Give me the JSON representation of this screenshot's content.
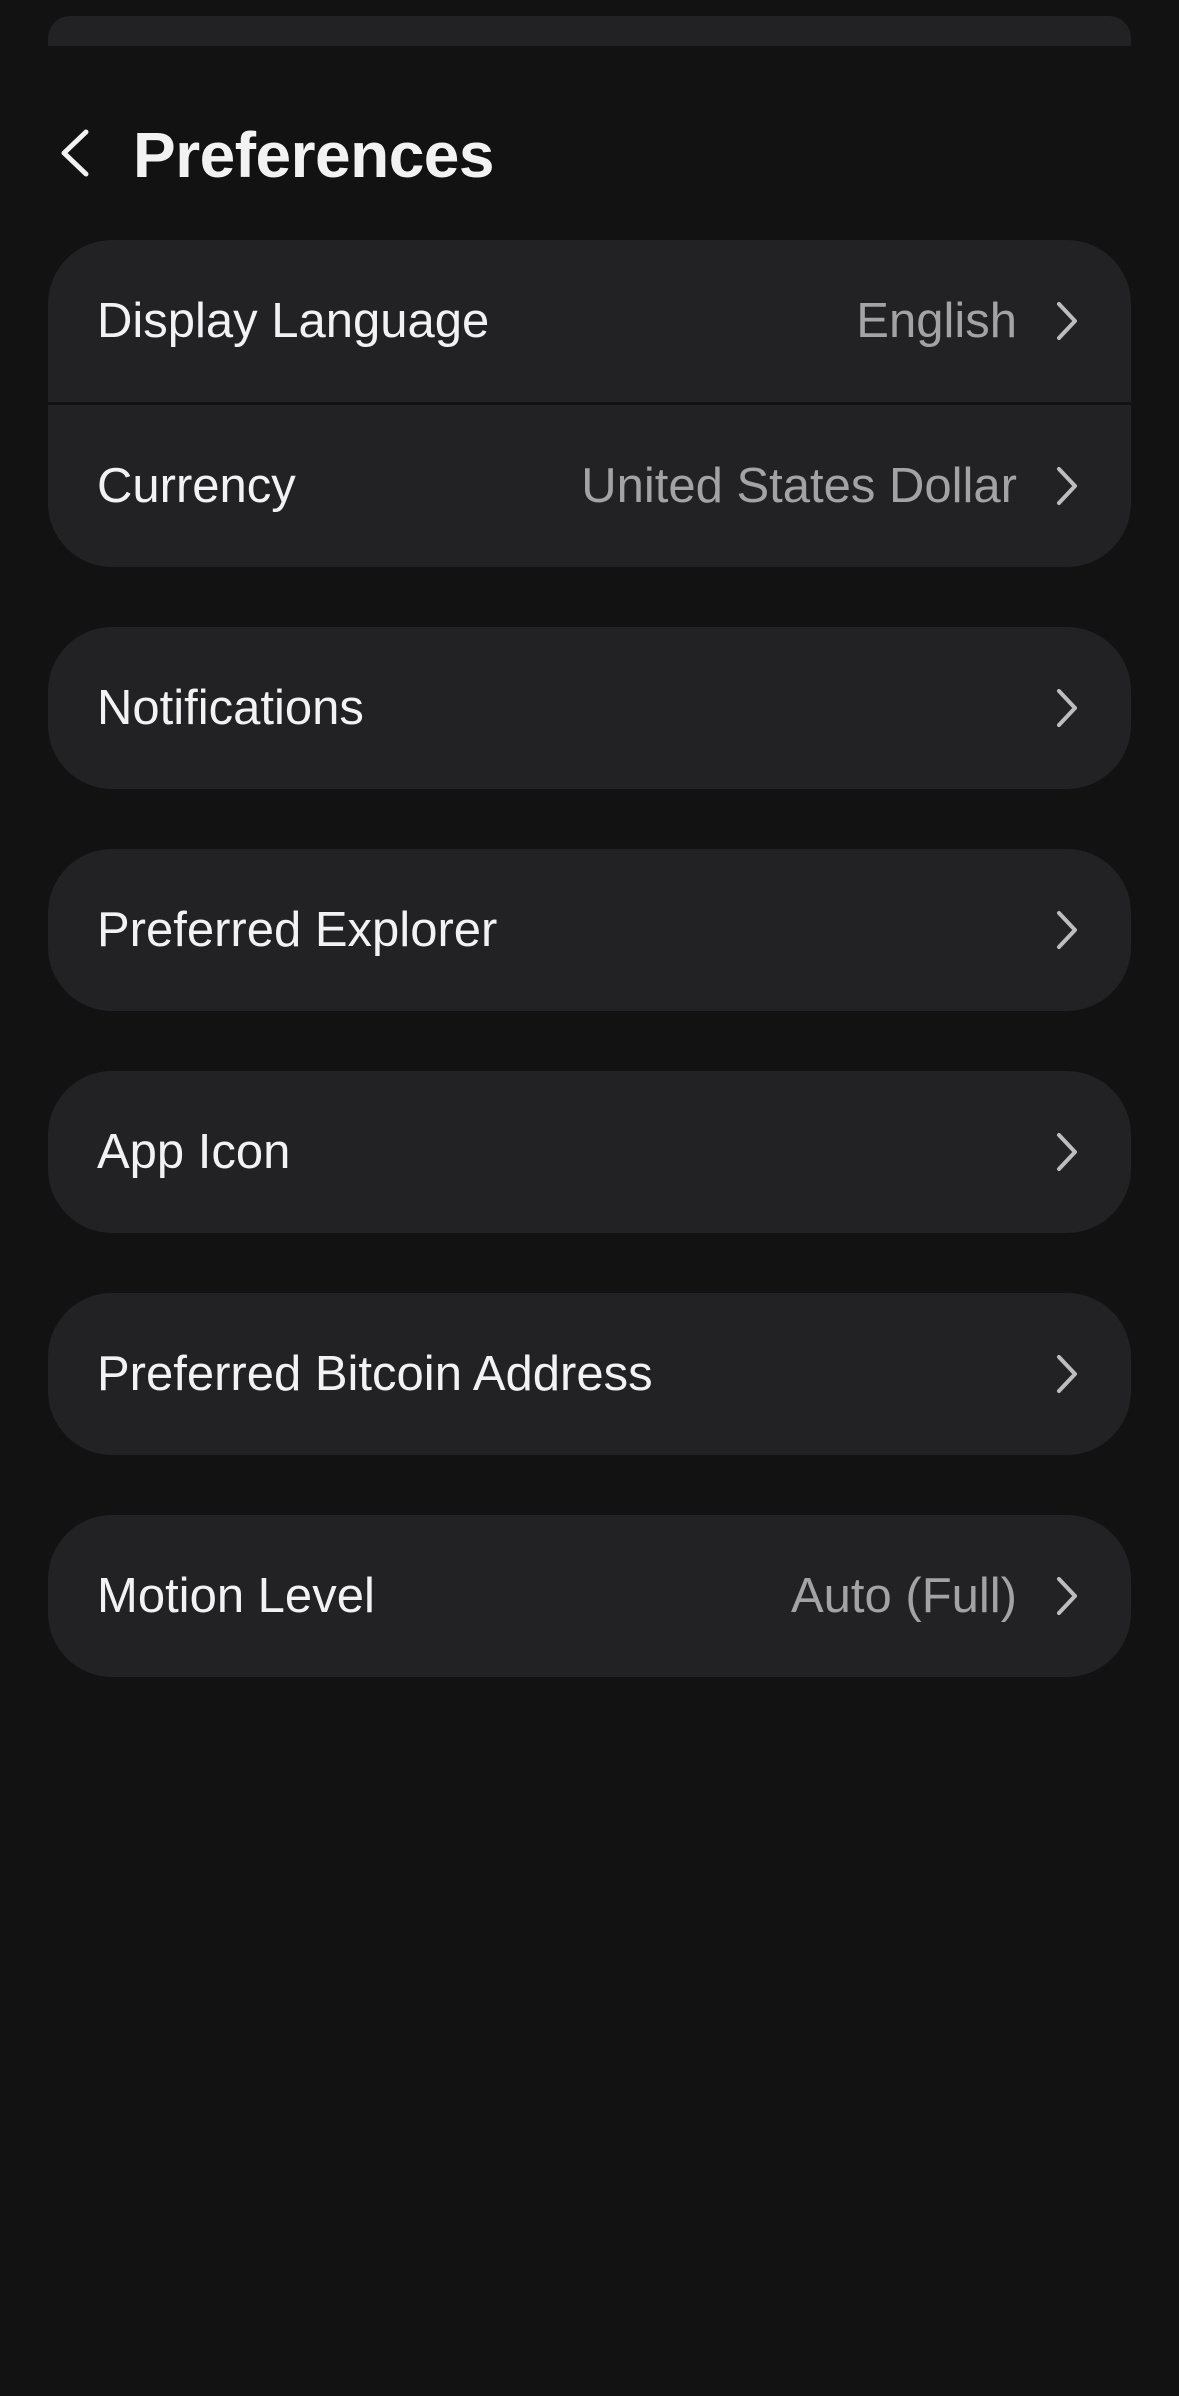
{
  "header": {
    "title": "Preferences",
    "back_icon": "chevron-left-icon"
  },
  "groups": [
    {
      "rows": [
        {
          "label": "Display Language",
          "value": "English"
        },
        {
          "label": "Currency",
          "value": "United States Dollar"
        }
      ]
    },
    {
      "rows": [
        {
          "label": "Notifications",
          "value": ""
        }
      ]
    },
    {
      "rows": [
        {
          "label": "Preferred Explorer",
          "value": ""
        }
      ]
    },
    {
      "rows": [
        {
          "label": "App Icon",
          "value": ""
        }
      ]
    },
    {
      "rows": [
        {
          "label": "Preferred Bitcoin Address",
          "value": ""
        }
      ]
    },
    {
      "rows": [
        {
          "label": "Motion Level",
          "value": "Auto (Full)"
        }
      ]
    }
  ],
  "colors": {
    "background": "#121212",
    "card": "#222224",
    "text_primary": "#f2f2f2",
    "text_secondary": "#a3a3a6",
    "chevron": "#bdbdc0"
  },
  "icons": {
    "row_disclosure": "chevron-right-icon"
  }
}
